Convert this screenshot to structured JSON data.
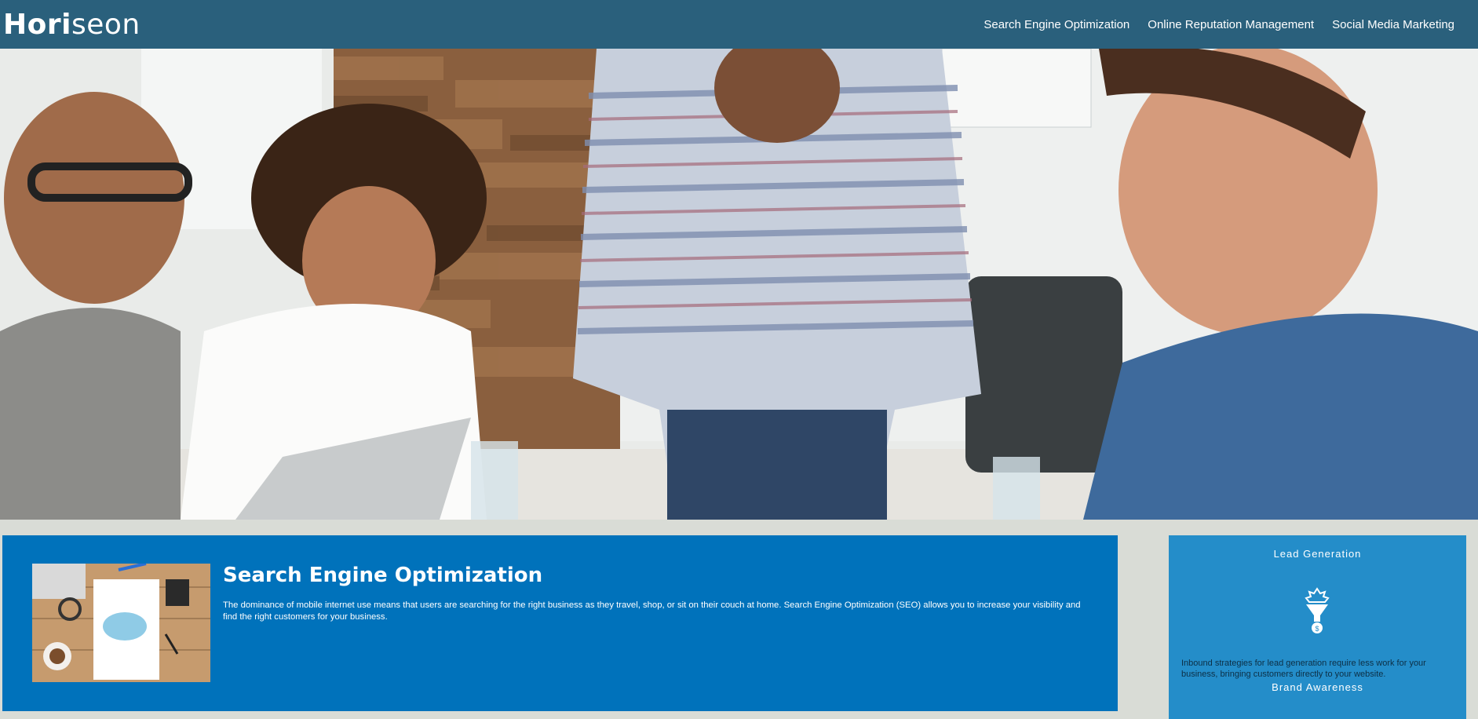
{
  "header": {
    "logo_main": "Hori",
    "logo_accent": "seon",
    "nav": [
      {
        "label": "Search Engine Optimization"
      },
      {
        "label": "Online Reputation Management"
      },
      {
        "label": "Social Media Marketing"
      }
    ]
  },
  "hero": {
    "image": "team-meeting-photo"
  },
  "content": {
    "title": "Search Engine Optimization",
    "body": "The dominance of mobile internet use means that users are searching for the right business as they travel, shop, or sit on their couch at home. Search Engine Optimization (SEO) allows you to increase your visibility and find the right customers for your business.",
    "image": "seo-notebook-image"
  },
  "benefits": {
    "lead_title": "Lead Generation",
    "lead_icon": "lead-generation-icon",
    "lead_body": "Inbound strategies for lead generation require less work for your business, bringing customers directly to your website.",
    "brand_title": "Brand Awareness"
  },
  "colors": {
    "header": "#2a607c",
    "content_bg": "#0072bb",
    "benefit_bg": "#248dc9",
    "page_bg": "#d9dcd6"
  }
}
